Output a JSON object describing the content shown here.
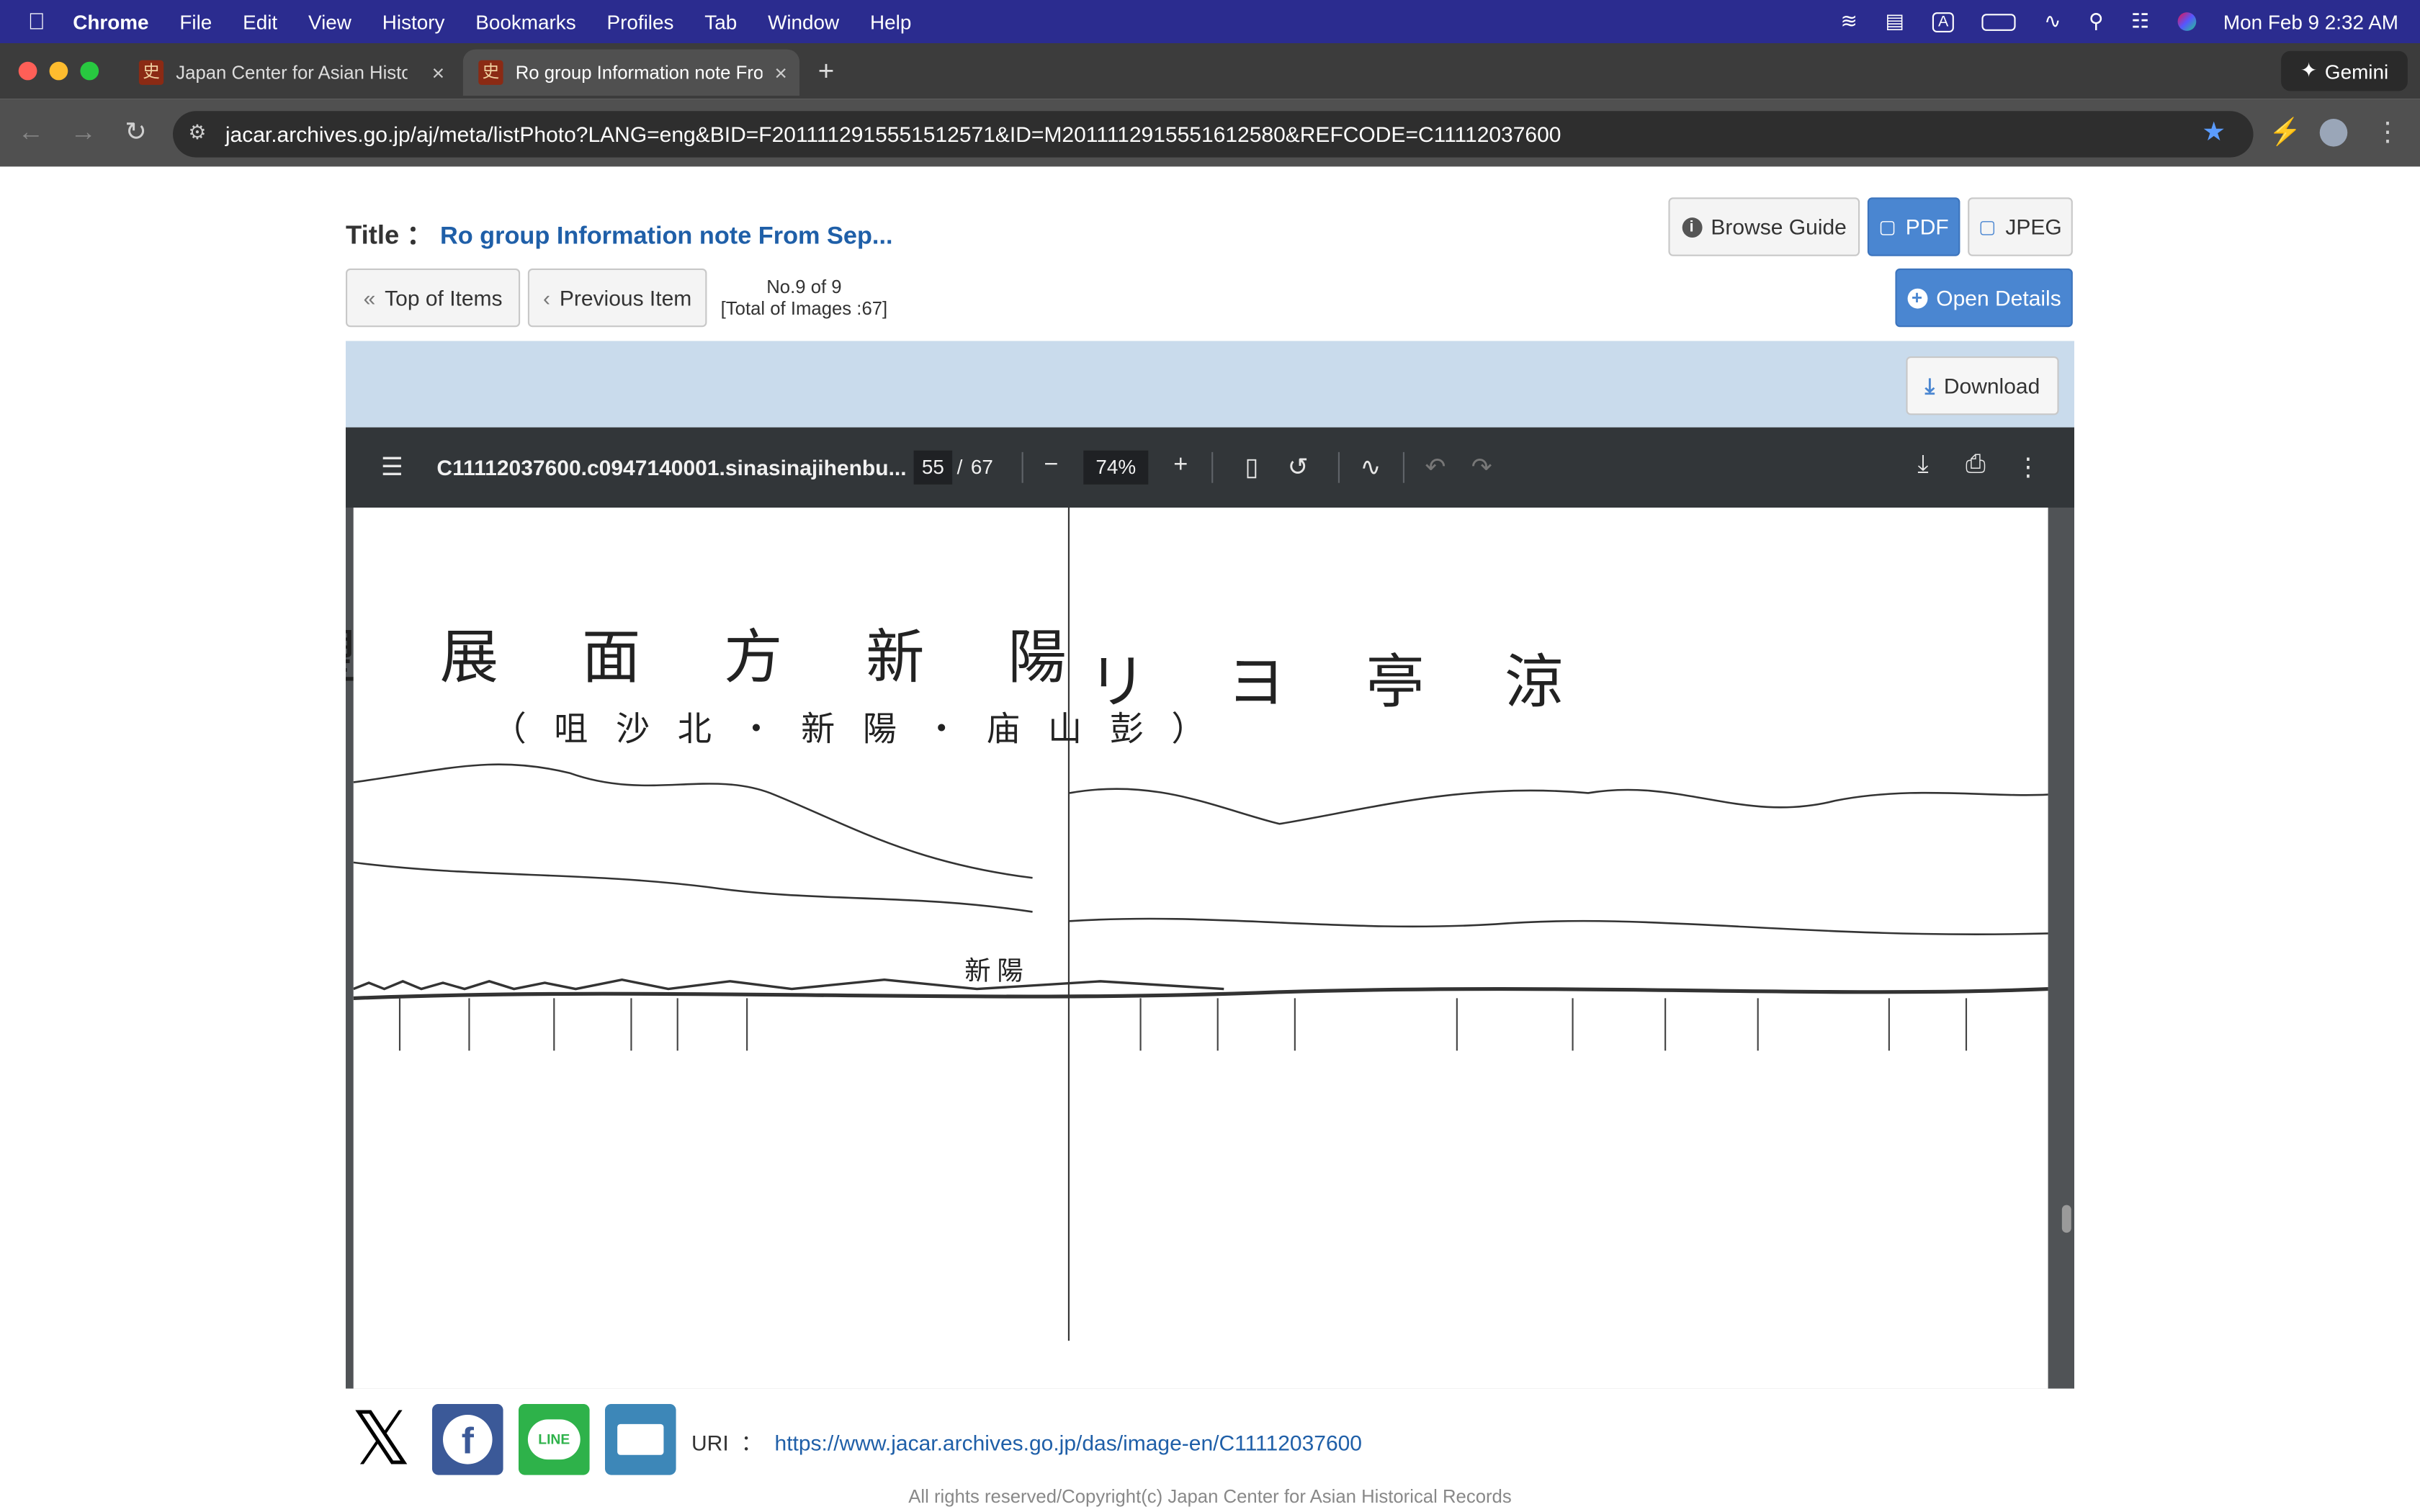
{
  "menubar": {
    "app": "Chrome",
    "items": [
      "File",
      "Edit",
      "View",
      "History",
      "Bookmarks",
      "Profiles",
      "Tab",
      "Window",
      "Help"
    ],
    "datetime": "Mon Feb 9  2:32 AM"
  },
  "tabs": [
    {
      "title": "Japan Center for Asian Histori",
      "favicon": "史"
    },
    {
      "title": "Ro group Information note Fro",
      "favicon": "史"
    }
  ],
  "gemini_label": "Gemini",
  "address": {
    "url": "jacar.archives.go.jp/aj/meta/listPhoto?LANG=eng&BID=F2011112915551512571&ID=M2011112915551612580&REFCODE=C11112037600"
  },
  "page": {
    "title_label": "Title",
    "title_sep": "：",
    "title_value": "Ro group Information note From Sep...",
    "buttons": {
      "browse_guide": "Browse Guide",
      "pdf": "PDF",
      "jpeg": "JPEG",
      "top_of_items": "Top of Items",
      "previous_item": "Previous Item",
      "open_details": "Open Details",
      "download": "Download"
    },
    "item_counter": "No.9 of 9",
    "total_images": "[Total of Images :67]"
  },
  "pdf_viewer": {
    "filename": "C11112037600.c0947140001.sinasinajihenbu...",
    "current_page": "55",
    "page_sep": "/",
    "total_pages": "67",
    "zoom": "74%"
  },
  "document_text": {
    "heading_left": "望展面方新陽",
    "heading_right": "リヨ亭涼",
    "subheading": "（咀沙北・新陽・庙山彭）",
    "town_label": "新陽"
  },
  "footer": {
    "uri_label": "URI",
    "uri_sep": "：",
    "uri_value": "https://www.jacar.archives.go.jp/das/image-en/C11112037600",
    "copyright": "All rights reserved/Copyright(c) Japan Center for Asian Historical Records"
  },
  "colors": {
    "menubar": "#2b2c8f",
    "link": "#1f5fa8",
    "accent": "#4a86d1",
    "facebook": "#3b5998",
    "line": "#2eb24a",
    "mail": "#3d87b8"
  }
}
